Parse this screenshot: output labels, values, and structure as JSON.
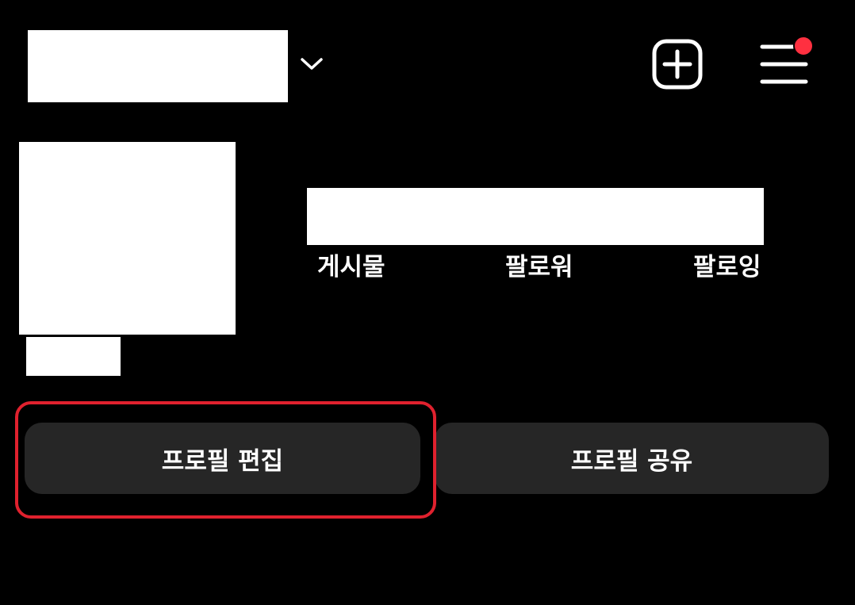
{
  "header": {
    "dropdown_icon": "chevron-down-icon",
    "add_icon": "plus-square-icon",
    "menu_icon": "hamburger-menu-icon",
    "notification_dot_color": "#ff3040"
  },
  "profile": {
    "stats": {
      "posts_label": "게시물",
      "followers_label": "팔로워",
      "following_label": "팔로잉"
    }
  },
  "actions": {
    "edit_profile_label": "프로필 편집",
    "share_profile_label": "프로필 공유"
  },
  "annotation": {
    "highlight_color": "#e0212e"
  }
}
